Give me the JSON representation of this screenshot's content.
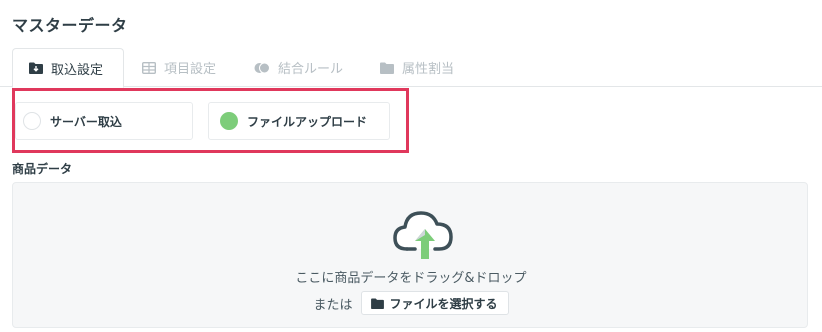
{
  "page": {
    "title": "マスターデータ"
  },
  "tabs": [
    {
      "label": "取込設定",
      "icon": "import-folder-icon",
      "active": true
    },
    {
      "label": "項目設定",
      "icon": "table-icon",
      "active": false
    },
    {
      "label": "結合ルール",
      "icon": "merge-icon",
      "active": false
    },
    {
      "label": "属性割当",
      "icon": "folder-icon",
      "active": false
    }
  ],
  "import_method": {
    "options": [
      {
        "label": "サーバー取込",
        "selected": false
      },
      {
        "label": "ファイルアップロード",
        "selected": true
      }
    ]
  },
  "section": {
    "label": "商品データ"
  },
  "dropzone": {
    "instruction": "ここに商品データをドラッグ&ドロップ",
    "or_label": "または",
    "button_label": "ファイルを選択する"
  },
  "colors": {
    "accent": "#7dcd7a",
    "highlight_border": "#e0385c",
    "text_dark": "#2f3e46",
    "text_muted": "#b7bfc4"
  }
}
